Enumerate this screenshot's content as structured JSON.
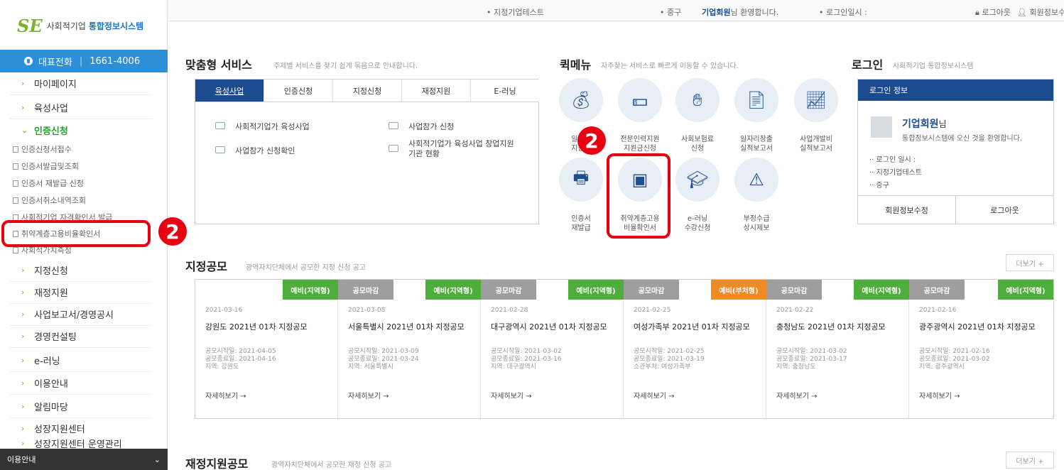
{
  "brand": {
    "mark": "SE",
    "prefix": "사회적기업",
    "name": "통합정보시스템"
  },
  "phone": {
    "label": "대표전화",
    "number": "1661-4006"
  },
  "sidebar": {
    "menus": [
      "마이페이지",
      "육성사업",
      "인증신청",
      "지정신청",
      "재정지원",
      "사업보고서/경영공시",
      "경영컨설팅",
      "e-러닝",
      "이용안내",
      "알림마당",
      "성장지원센터",
      "성장지원센터 운영관리"
    ],
    "subs": [
      "인증신청서접수",
      "인증서발급및조회",
      "인증서 재발급 신청",
      "인증서취소내역조회",
      "취약계층고용비율확인서",
      "사회적기업 자격확인서 발급",
      "사회적가치측정"
    ],
    "footer": "이용안내"
  },
  "topbar": {
    "org": "• 지정기업테스트",
    "region": "• 중구",
    "user": "기업회원",
    "welcome": "님 환영합니다.",
    "login_time": "• 로그인일시 :",
    "logout": "로그아웃",
    "edit": "회원정보수정"
  },
  "custom": {
    "title": "맞춤형 서비스",
    "desc": "주제별 서비스를 찾기 쉽게 묶음으로 안내합니다.",
    "tabs": [
      "육성사업",
      "인증신청",
      "지정신청",
      "재정지원",
      "E-러닝"
    ],
    "items": [
      "사회적기업가 육성사업",
      "사업참가 신청",
      "사업참가 신청확인",
      "사회적기업가 육성사업 창업지원기관 현황"
    ]
  },
  "quick": {
    "title": "퀵메뉴",
    "desc": "자주찾는 서비스로 빠르게 이동할 수 있습니다.",
    "row1": [
      [
        "일자리",
        "지원금"
      ],
      [
        "전문인력지원",
        "지원금신청"
      ],
      [
        "사회보험료",
        "신청"
      ],
      [
        "일자리창출",
        "실적보고서"
      ],
      [
        "사업개발비",
        "실적보고서"
      ]
    ],
    "row2": [
      [
        "인증서",
        "재발급"
      ],
      [
        "취약계층고용",
        "비율확인서"
      ],
      [
        "e-러닝",
        "수강신청"
      ],
      [
        "부정수급",
        "상시제보"
      ]
    ]
  },
  "login": {
    "title": "로그인",
    "desc": "사회적기업 통합정보시스템",
    "header": "로그인 정보",
    "user": "기업회원",
    "honor": "님",
    "welcome": "통합정보시스템에 오신 것을 환영합니다.",
    "lines": [
      "로그인 일시 :",
      "지정기업테스트",
      "중구"
    ],
    "btn_edit": "회원정보수정",
    "btn_logout": "로그아웃"
  },
  "notice": {
    "title": "지정공모",
    "desc": "광역자치단체에서 공모한 지정 신청 공고",
    "more": "더보기 +",
    "cards": [
      {
        "badge": "예비(지역형)",
        "color": "#4fae3b",
        "date": "2021-03-16",
        "title": "강원도 2021년 01차 지정공모",
        "m1": "공모시작일: 2021-04-05",
        "m2": "공모종료일: 2021-04-16",
        "m3": "지역: 강원도"
      },
      {
        "badge": "예비(지역형)",
        "color": "#4fae3b",
        "date": "2021-03-08",
        "title": "서울특별시 2021년 01차 지정공모",
        "m1": "공모시작일: 2021-03-09",
        "m2": "공모종료일: 2021-03-24",
        "m3": "지역: 서울특별시"
      },
      {
        "badge": "예비(지역형)",
        "color": "#4fae3b",
        "date": "2021-02-28",
        "title": "대구광역시 2021년 01차 지정공모",
        "m1": "공모시작일: 2021-03-02",
        "m2": "공모종료일: 2021-03-16",
        "m3": "지역: 대구광역시"
      },
      {
        "badge": "예비(부처형)",
        "color": "#f08a24",
        "date": "2021-02-25",
        "title": "여성가족부 2021년 01차 지정공모",
        "m1": "공모시작일: 2021-02-25",
        "m2": "공모종료일: 2021-03-19",
        "m3": "소관부처: 여성가족부"
      },
      {
        "badge": "예비(지역형)",
        "color": "#4fae3b",
        "date": "2021-02-22",
        "title": "충청남도 2021년 01차 지정공모",
        "m1": "공모시작일: 2021-03-02",
        "m2": "공모종료일: 2021-03-17",
        "m3": "지역: 충청남도"
      },
      {
        "badge": "예비(지역형)",
        "color": "#4fae3b",
        "date": "2021-02-16",
        "title": "광주광역시 2021년 01차 지정공모",
        "m1": "공모시작일: 2021-02-16",
        "m2": "공모종료일: 2021-03-02",
        "m3": "지역: 광주광역시"
      }
    ],
    "closed": "공모마감",
    "detail": "자세히보기 →"
  },
  "finance": {
    "title": "재정지원공모",
    "desc": "광역자치단체에서 공모한 재정 신청 공고",
    "more": "더보기 +"
  },
  "annotation": {
    "number": "2"
  }
}
